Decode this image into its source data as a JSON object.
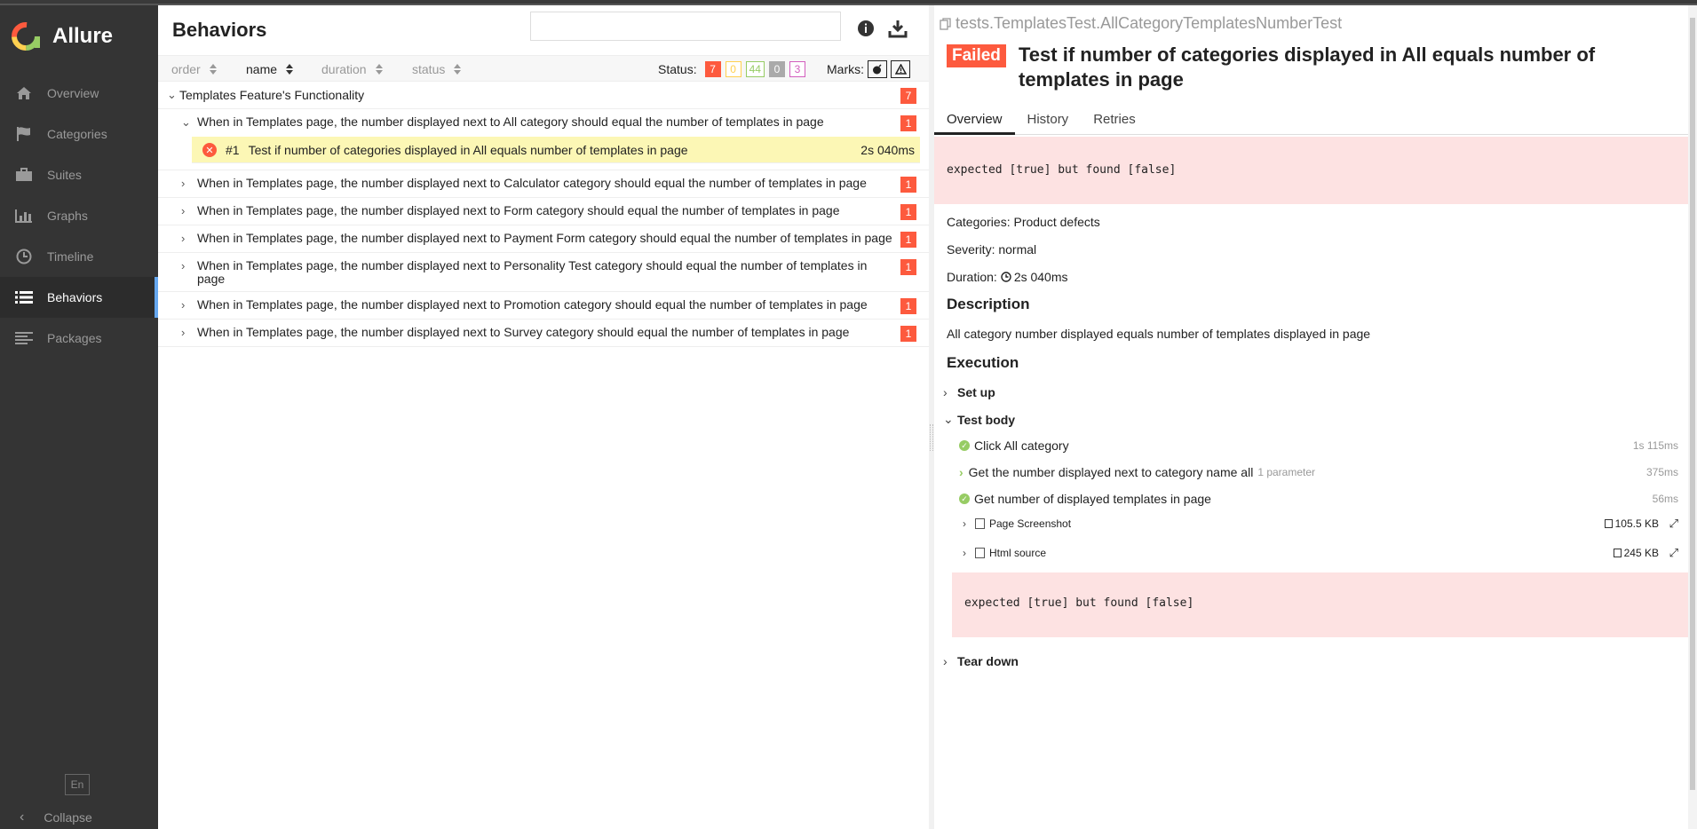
{
  "app": {
    "name": "Allure"
  },
  "sidebar": {
    "items": [
      {
        "label": "Overview",
        "icon": "home-icon"
      },
      {
        "label": "Categories",
        "icon": "flag-icon"
      },
      {
        "label": "Suites",
        "icon": "briefcase-icon"
      },
      {
        "label": "Graphs",
        "icon": "bar-chart-icon"
      },
      {
        "label": "Timeline",
        "icon": "clock-icon"
      },
      {
        "label": "Behaviors",
        "icon": "list-icon",
        "active": true
      },
      {
        "label": "Packages",
        "icon": "align-left-icon"
      }
    ],
    "lang": "En",
    "collapse_label": "Collapse"
  },
  "behaviors": {
    "title": "Behaviors",
    "search": {
      "value": "",
      "placeholder": ""
    },
    "sort": {
      "order": "order",
      "name": "name",
      "duration": "duration",
      "status": "status"
    },
    "status_label": "Status:",
    "status_counts": {
      "failed": "7",
      "broken": "0",
      "passed": "44",
      "skipped": "0",
      "unknown": "3"
    },
    "marks_label": "Marks:",
    "group": {
      "label": "Templates Feature's Functionality",
      "count": "7"
    },
    "stories": [
      {
        "label": "When in Templates page, the number displayed next to All category should equal the number of templates in page",
        "count": "1",
        "expanded": true
      },
      {
        "label": "When in Templates page, the number displayed next to Calculator category should equal the number of templates in page",
        "count": "1"
      },
      {
        "label": "When in Templates page, the number displayed next to Form category should equal the number of templates in page",
        "count": "1"
      },
      {
        "label": "When in Templates page, the number displayed next to Payment Form category should equal the number of templates in page",
        "count": "1"
      },
      {
        "label": "When in Templates page, the number displayed next to Personality Test category should equal the number of templates in page",
        "count": "1"
      },
      {
        "label": "When in Templates page, the number displayed next to Promotion category should equal the number of templates in page",
        "count": "1"
      },
      {
        "label": "When in Templates page, the number displayed next to Survey category should equal the number of templates in page",
        "count": "1"
      }
    ],
    "test": {
      "num": "#1",
      "label": "Test if number of categories displayed in All equals number of templates in page",
      "duration": "2s 040ms"
    }
  },
  "detail": {
    "path": "tests.TemplatesTest.AllCategoryTemplatesNumberTest",
    "status": "Failed",
    "title": "Test if number of categories displayed in All equals number of templates in page",
    "tabs": [
      "Overview",
      "History",
      "Retries"
    ],
    "error": "expected [true] but found [false]",
    "categories_label": "Categories:",
    "categories_value": "Product defects",
    "severity_label": "Severity:",
    "severity_value": "normal",
    "duration_label": "Duration:",
    "duration_value": "2s 040ms",
    "description_title": "Description",
    "description": "All category number displayed equals number of templates displayed in page",
    "execution_title": "Execution",
    "setup_label": "Set up",
    "body_label": "Test body",
    "teardown_label": "Tear down",
    "steps": [
      {
        "label": "Click All category",
        "time": "1s 115ms"
      },
      {
        "label": "Get the number displayed next to category name all",
        "param": "1 parameter",
        "time": "375ms"
      },
      {
        "label": "Get number of displayed templates in page",
        "time": "56ms"
      }
    ],
    "attachments": [
      {
        "label": "Page Screenshot",
        "size": "105.5 KB"
      },
      {
        "label": "Html source",
        "size": "245 KB"
      }
    ],
    "step_error": "expected [true] but found [false]"
  },
  "colors": {
    "failed": "#fd5a3e",
    "broken": "#ffd050",
    "passed": "#97cc64",
    "skipped": "#aaaaaa",
    "unknown": "#d35ebe",
    "sidebar": "#343434",
    "accent": "#66a8f0"
  }
}
